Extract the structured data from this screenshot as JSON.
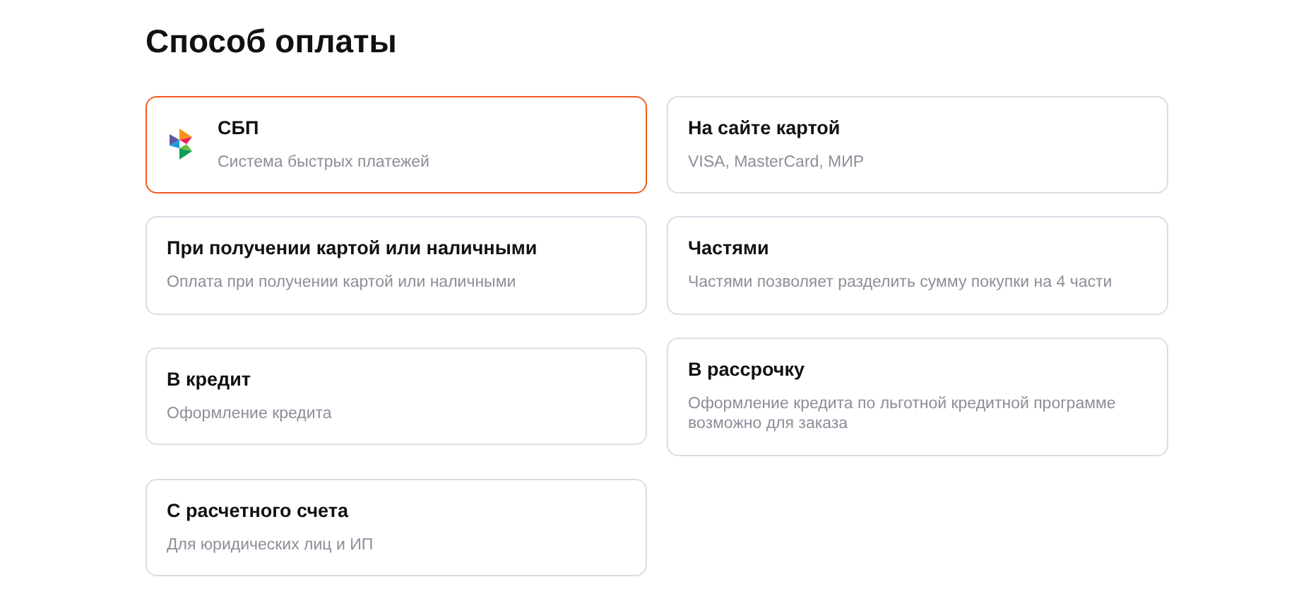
{
  "title": "Способ оплаты",
  "options": [
    {
      "kind": "with-icon",
      "title": "СБП",
      "description": "Система быстрых платежей",
      "selected": true
    },
    {
      "kind": "plain",
      "title": "На сайте картой",
      "description": "VISA, MasterCard, МИР",
      "selected": false
    },
    {
      "kind": "plain",
      "title": "При получении картой или наличными",
      "description": "Оплата при получении картой или наличными",
      "selected": false
    },
    {
      "kind": "plain",
      "title": "Частями",
      "description": "Частями позволяет разделить сумму покупки на 4 части",
      "selected": false
    },
    {
      "kind": "plain",
      "title": "В кредит",
      "description": "Оформление кредита",
      "selected": false
    },
    {
      "kind": "plain",
      "title": "В рассрочку",
      "description": "Оформление кредита по льготной кредитной программе возможно для заказа",
      "selected": false
    },
    {
      "kind": "plain",
      "title": "С расчетного счета",
      "description": "Для юридических лиц и ИП",
      "selected": false
    }
  ]
}
